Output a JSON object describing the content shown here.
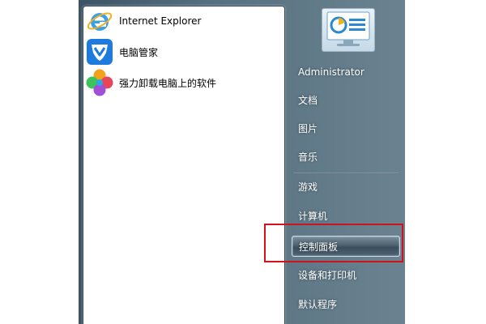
{
  "start_menu": {
    "programs": [
      {
        "label": "Internet Explorer",
        "icon": "ie-icon"
      },
      {
        "label": "电脑管家",
        "icon": "tencent-pc-manager-icon"
      },
      {
        "label": "强力卸载电脑上的软件",
        "icon": "uninstaller-icon"
      }
    ],
    "user_name": "Administrator",
    "right_items": [
      {
        "label": "文档"
      },
      {
        "label": "图片"
      },
      {
        "label": "音乐"
      },
      {
        "label": "游戏"
      },
      {
        "label": "计算机"
      },
      {
        "label": "控制面板"
      },
      {
        "label": "设备和打印机"
      },
      {
        "label": "默认程序"
      }
    ]
  },
  "colors": {
    "menu_gradient_dark": "#3d5366",
    "highlight_annotation": "#d0121b",
    "ie_blue": "#2f8fd8",
    "pc_manager_blue": "#1d7be0"
  }
}
